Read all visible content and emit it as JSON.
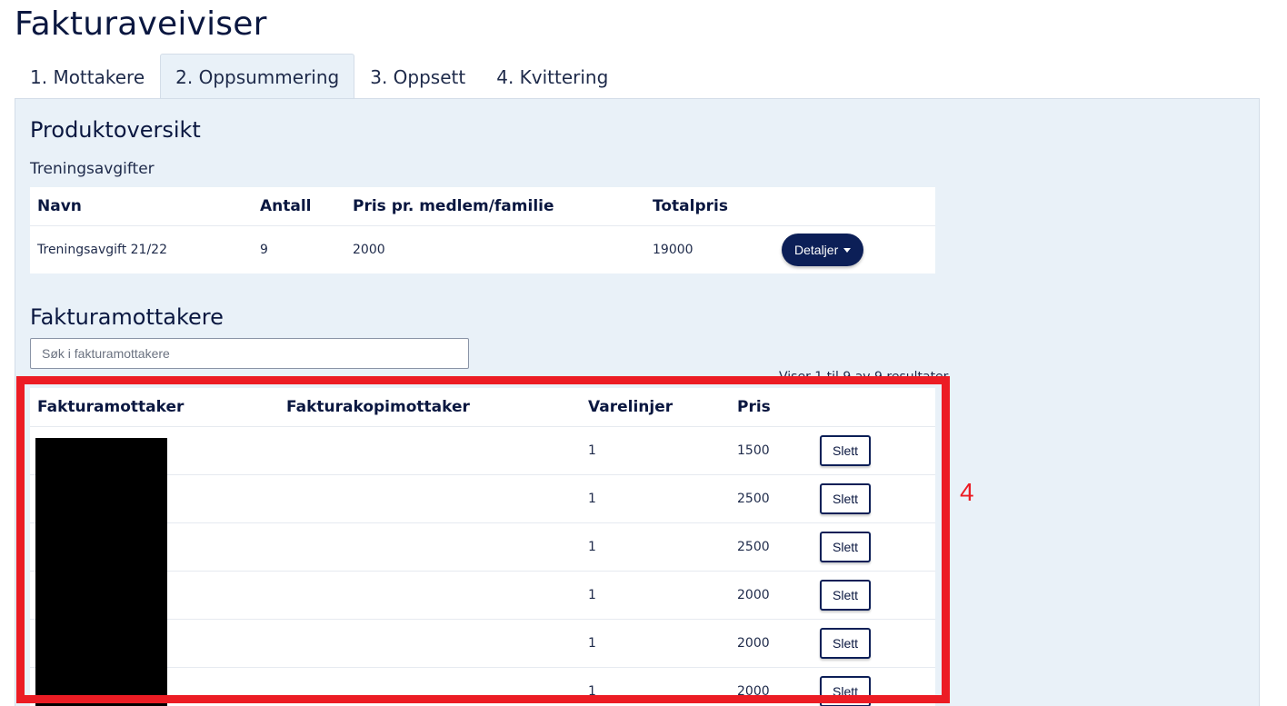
{
  "page": {
    "title": "Fakturaveiviser"
  },
  "tabs": [
    {
      "label": "1. Mottakere"
    },
    {
      "label": "2. Oppsummering"
    },
    {
      "label": "3. Oppsett"
    },
    {
      "label": "4. Kvittering"
    }
  ],
  "products": {
    "title": "Produktoversikt",
    "category": "Treningsavgifter",
    "headers": {
      "name": "Navn",
      "count": "Antall",
      "price": "Pris pr. medlem/familie",
      "total": "Totalpris"
    },
    "rows": [
      {
        "name": "Treningsavgift 21/22",
        "count": "9",
        "price": "2000",
        "total": "19000",
        "action_label": "Detaljer"
      }
    ]
  },
  "recipients": {
    "title": "Fakturamottakere",
    "search_placeholder": "Søk i fakturamottakere",
    "results_info": "Viser 1 til 9 av 9 resultater",
    "headers": {
      "recipient": "Fakturamottaker",
      "copy_recipient": "Fakturakopimottaker",
      "lines": "Varelinjer",
      "price": "Pris"
    },
    "rows": [
      {
        "lines": "1",
        "price": "1500",
        "action_label": "Slett"
      },
      {
        "lines": "1",
        "price": "2500",
        "action_label": "Slett"
      },
      {
        "lines": "1",
        "price": "2500",
        "action_label": "Slett"
      },
      {
        "lines": "1",
        "price": "2000",
        "action_label": "Slett"
      },
      {
        "lines": "1",
        "price": "2000",
        "action_label": "Slett"
      },
      {
        "lines": "1",
        "price": "2000",
        "action_label": "Slett"
      }
    ]
  },
  "annotation": {
    "label": "4",
    "color": "#ec1c24"
  },
  "colors": {
    "primary": "#0c1f57",
    "panel_bg": "#e9f1f8"
  }
}
